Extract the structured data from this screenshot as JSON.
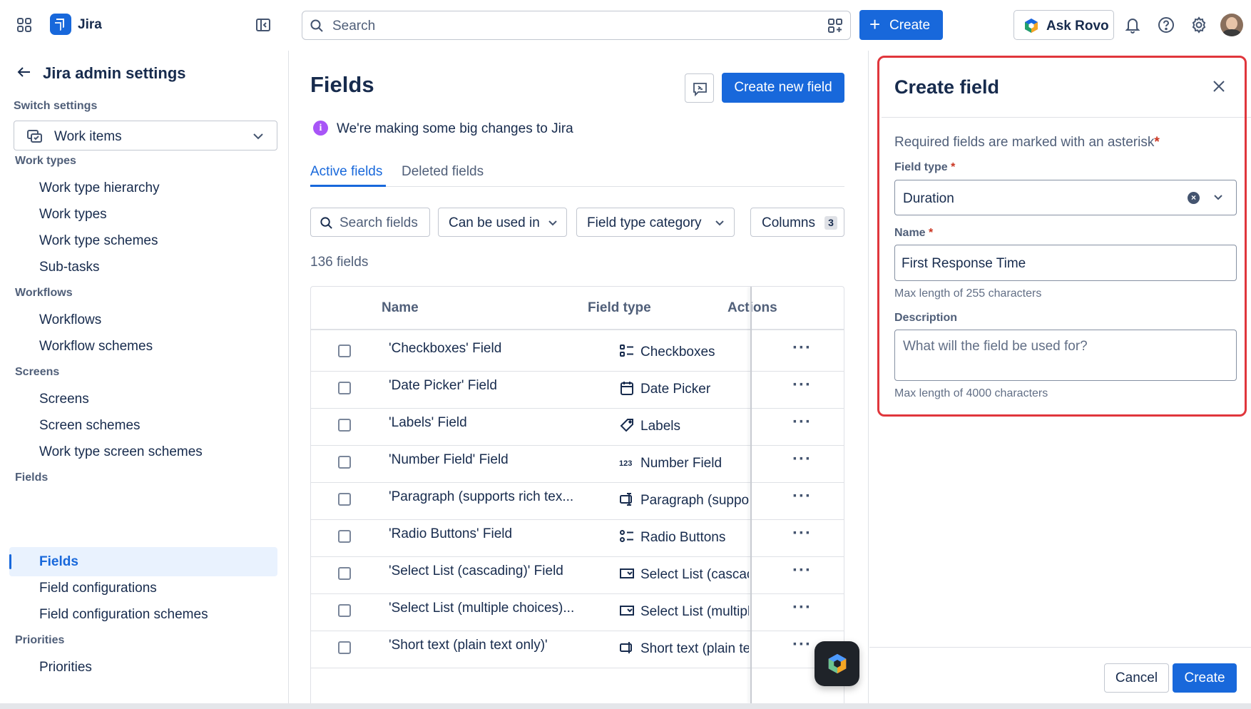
{
  "topbar": {
    "app_name": "Jira",
    "search_placeholder": "Search",
    "create_label": "Create",
    "ask_rovo_label": "Ask Rovo",
    "brand_color": "#1868db"
  },
  "sidebar": {
    "title": "Jira admin settings",
    "switch_label": "Switch settings",
    "switch_value": "Work items",
    "sections": {
      "work_types": {
        "heading": "Work types",
        "items": [
          "Work type hierarchy",
          "Work types",
          "Work type schemes",
          "Sub-tasks"
        ]
      },
      "workflows": {
        "heading": "Workflows",
        "items": [
          "Workflows",
          "Workflow schemes"
        ]
      },
      "screens": {
        "heading": "Screens",
        "items": [
          "Screens",
          "Screen schemes",
          "Work type screen schemes"
        ]
      },
      "fields": {
        "heading": "Fields",
        "items": [
          "Fields",
          "Field configurations",
          "Field configuration schemes"
        ]
      },
      "priorities": {
        "heading": "Priorities",
        "items": [
          "Priorities"
        ]
      }
    },
    "active_item": "Fields"
  },
  "main": {
    "title": "Fields",
    "create_new_field_label": "Create new field",
    "info_message": "We're making some big changes to Jira",
    "tabs": [
      "Active fields",
      "Deleted fields"
    ],
    "active_tab": "Active fields",
    "filters": {
      "search_placeholder": "Search fields",
      "can_be_used_in": "Can be used in",
      "field_type_category": "Field type category",
      "columns": "Columns",
      "columns_count": "3"
    },
    "field_count": "136 fields",
    "table": {
      "headers": {
        "name": "Name",
        "field_type": "Field type",
        "actions": "Actions"
      },
      "rows": [
        {
          "name": "'Checkboxes' Field",
          "type": "Checkboxes",
          "icon": "checklist-icon"
        },
        {
          "name": "'Date Picker' Field",
          "type": "Date Picker",
          "icon": "calendar-icon"
        },
        {
          "name": "'Labels' Field",
          "type": "Labels",
          "icon": "tag-icon"
        },
        {
          "name": "'Number Field' Field",
          "type": "Number Field",
          "icon": "number-icon"
        },
        {
          "name": "'Paragraph (supports rich tex...",
          "type": "Paragraph (suppor",
          "icon": "paragraph-icon"
        },
        {
          "name": "'Radio Buttons' Field",
          "type": "Radio Buttons",
          "icon": "radio-list-icon"
        },
        {
          "name": "'Select List (cascading)' Field",
          "type": "Select List (cascac",
          "icon": "select-list-icon"
        },
        {
          "name": "'Select List (multiple choices)...",
          "type": "Select List (multipl",
          "icon": "select-list-icon"
        },
        {
          "name": "'Short text (plain text only)'",
          "type": "Short text (plain te",
          "icon": "short-text-icon"
        }
      ]
    }
  },
  "panel": {
    "title": "Create field",
    "required_note": "Required fields are marked with an asterisk",
    "asterisk": "*",
    "field_type_label": "Field type",
    "field_type_value": "Duration",
    "name_label": "Name",
    "name_value": "First Response Time",
    "name_help": "Max length of 255 characters",
    "description_label": "Description",
    "description_placeholder": "What will the field be used for?",
    "description_help": "Max length of 4000 characters",
    "cancel_label": "Cancel",
    "submit_label": "Create",
    "highlight_color": "#e0363c"
  }
}
